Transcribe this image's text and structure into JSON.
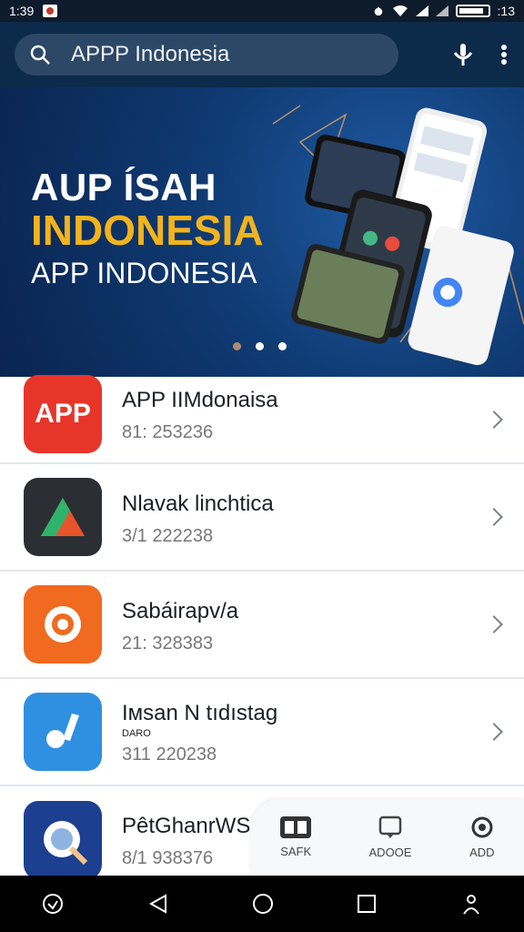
{
  "status_bar": {
    "time": "1:39",
    "battery_text": ":13"
  },
  "search": {
    "query": "APPP Indonesia"
  },
  "banner": {
    "title_line1": "AUP ÍSAH",
    "title_line2": "INDONESIA",
    "title_line3": "APP INDONESIA",
    "active_slide": 1,
    "slide_count": 3
  },
  "apps": [
    {
      "name": "APP IIMdonaisa",
      "sub": "81: 253236",
      "icon_text": "APP",
      "icon_color": "#e7352a"
    },
    {
      "name": "Nlavak linchtica",
      "sub": "3/1 222238",
      "icon_color": "#2b2f33"
    },
    {
      "name": "Sabáirapv/a",
      "sub": "21: 328383",
      "icon_color": "#f06a1f"
    },
    {
      "name": "Iмsan N tıdıstag",
      "extra": "DARO",
      "sub": "311 220238",
      "icon_color": "#2f8fe0"
    },
    {
      "name": "PêtGhanrWSz",
      "sub": "8/1 938376",
      "icon_color": "#1c3f8f"
    }
  ],
  "tabs": [
    {
      "label": "SAFK",
      "icon": "news-icon"
    },
    {
      "label": "ADOOE",
      "icon": "chat-icon"
    },
    {
      "label": "ADD",
      "icon": "settings-icon"
    }
  ],
  "colors": {
    "accent": "#f2b31c",
    "app_bar": "#0c2a4a"
  }
}
